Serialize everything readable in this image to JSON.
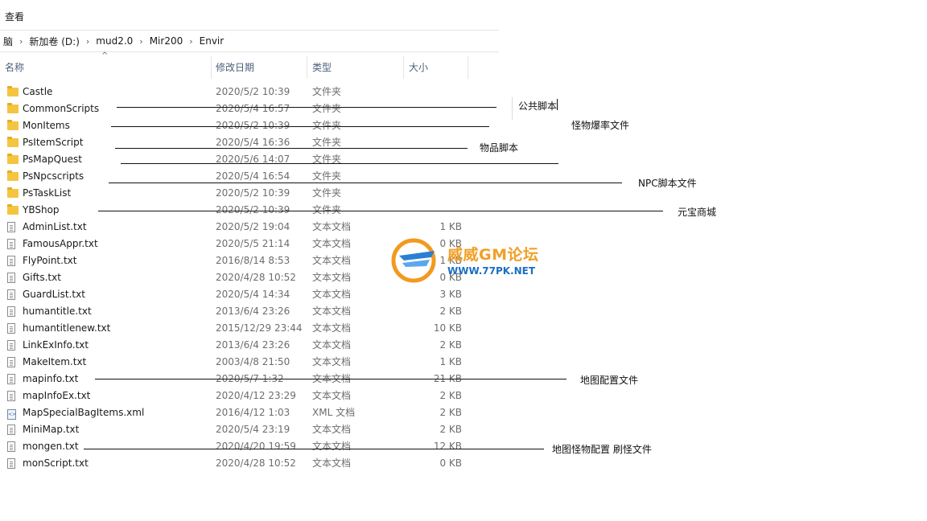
{
  "menu": {
    "view_label": "查看"
  },
  "breadcrumb": [
    "脑",
    "新加卷 (D:)",
    "mud2.0",
    "Mir200",
    "Envir"
  ],
  "columns": {
    "name": "名称",
    "date": "修改日期",
    "type": "类型",
    "size": "大小"
  },
  "files": [
    {
      "name": "Castle",
      "date": "2020/5/2 10:39",
      "type": "文件夹",
      "size": "",
      "icon": "folder-icon"
    },
    {
      "name": "CommonScripts",
      "date": "2020/5/4 16:57",
      "type": "文件夹",
      "size": "",
      "icon": "folder-icon"
    },
    {
      "name": "MonItems",
      "date": "2020/5/2 10:39",
      "type": "文件夹",
      "size": "",
      "icon": "folder-icon"
    },
    {
      "name": "PsItemScript",
      "date": "2020/5/4 16:36",
      "type": "文件夹",
      "size": "",
      "icon": "folder-icon"
    },
    {
      "name": "PsMapQuest",
      "date": "2020/5/6 14:07",
      "type": "文件夹",
      "size": "",
      "icon": "folder-icon"
    },
    {
      "name": "PsNpcscripts",
      "date": "2020/5/4 16:54",
      "type": "文件夹",
      "size": "",
      "icon": "folder-icon"
    },
    {
      "name": "PsTaskList",
      "date": "2020/5/2 10:39",
      "type": "文件夹",
      "size": "",
      "icon": "folder-icon"
    },
    {
      "name": "YBShop",
      "date": "2020/5/2 10:39",
      "type": "文件夹",
      "size": "",
      "icon": "folder-icon"
    },
    {
      "name": "AdminList.txt",
      "date": "2020/5/2 19:04",
      "type": "文本文档",
      "size": "1 KB",
      "icon": "text-file-icon"
    },
    {
      "name": "FamousAppr.txt",
      "date": "2020/5/5 21:14",
      "type": "文本文档",
      "size": "0 KB",
      "icon": "text-file-icon"
    },
    {
      "name": "FlyPoint.txt",
      "date": "2016/8/14 8:53",
      "type": "文本文档",
      "size": "1 KB",
      "icon": "text-file-icon"
    },
    {
      "name": "Gifts.txt",
      "date": "2020/4/28 10:52",
      "type": "文本文档",
      "size": "0 KB",
      "icon": "text-file-icon"
    },
    {
      "name": "GuardList.txt",
      "date": "2020/5/4 14:34",
      "type": "文本文档",
      "size": "3 KB",
      "icon": "text-file-icon"
    },
    {
      "name": "humantitle.txt",
      "date": "2013/6/4 23:26",
      "type": "文本文档",
      "size": "2 KB",
      "icon": "text-file-icon"
    },
    {
      "name": "humantitlenew.txt",
      "date": "2015/12/29 23:44",
      "type": "文本文档",
      "size": "10 KB",
      "icon": "text-file-icon"
    },
    {
      "name": "LinkExInfo.txt",
      "date": "2013/6/4 23:26",
      "type": "文本文档",
      "size": "2 KB",
      "icon": "text-file-icon"
    },
    {
      "name": "MakeItem.txt",
      "date": "2003/4/8 21:50",
      "type": "文本文档",
      "size": "1 KB",
      "icon": "text-file-icon"
    },
    {
      "name": "mapinfo.txt",
      "date": "2020/5/7 1:32",
      "type": "文本文档",
      "size": "21 KB",
      "icon": "text-file-icon"
    },
    {
      "name": "mapInfoEx.txt",
      "date": "2020/4/12 23:29",
      "type": "文本文档",
      "size": "2 KB",
      "icon": "text-file-icon"
    },
    {
      "name": "MapSpecialBagItems.xml",
      "date": "2016/4/12 1:03",
      "type": "XML 文档",
      "size": "2 KB",
      "icon": "xml-file-icon"
    },
    {
      "name": "MiniMap.txt",
      "date": "2020/5/4 23:19",
      "type": "文本文档",
      "size": "2 KB",
      "icon": "text-file-icon"
    },
    {
      "name": "mongen.txt",
      "date": "2020/4/20 19:59",
      "type": "文本文档",
      "size": "12 KB",
      "icon": "text-file-icon"
    },
    {
      "name": "monScript.txt",
      "date": "2020/4/28 10:52",
      "type": "文本文档",
      "size": "0 KB",
      "icon": "text-file-icon"
    }
  ],
  "annotations": {
    "common_scripts": "公共脚本",
    "mon_items": "怪物爆率文件",
    "item_script": "物品脚本",
    "npc_scripts": "NPC脚本文件",
    "yb_shop": "元宝商城",
    "mapinfo": "地图配置文件",
    "mongen": "地图怪物配置  刷怪文件"
  },
  "watermark": {
    "title": "威威GM论坛",
    "url": "WWW.77PK.NET"
  }
}
